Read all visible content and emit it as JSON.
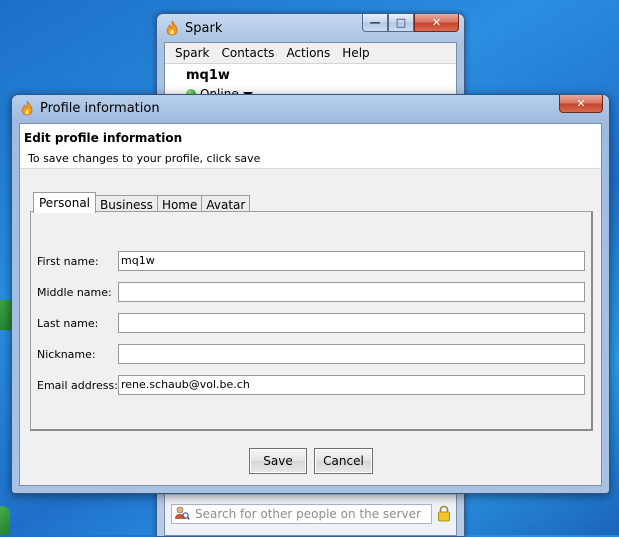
{
  "spark_window": {
    "title": "Spark",
    "menu": [
      "Spark",
      "Contacts",
      "Actions",
      "Help"
    ],
    "username": "mq1w",
    "status": "Online",
    "search_placeholder": "Search for other people on the server",
    "caption_minimize": "—",
    "caption_maximize": "□",
    "caption_close": "✕"
  },
  "dialog": {
    "title": "Profile information",
    "close": "✕",
    "header_title": "Edit profile information",
    "header_subtitle": "To save changes to your profile, click save",
    "tabs": [
      {
        "label": "Personal",
        "active": true
      },
      {
        "label": "Business",
        "active": false
      },
      {
        "label": "Home",
        "active": false
      },
      {
        "label": "Avatar",
        "active": false
      }
    ],
    "fields": [
      {
        "label": "First name:",
        "value": "mq1w"
      },
      {
        "label": "Middle name:",
        "value": ""
      },
      {
        "label": "Last name:",
        "value": ""
      },
      {
        "label": "Nickname:",
        "value": ""
      },
      {
        "label": "Email address:",
        "value": "rene.schaub@vol.be.ch"
      }
    ],
    "save_label": "Save",
    "cancel_label": "Cancel"
  },
  "colors": {
    "desktop": "#2a7fd5",
    "title_bar": "#a9c2e3",
    "close_button": "#c4432b"
  }
}
